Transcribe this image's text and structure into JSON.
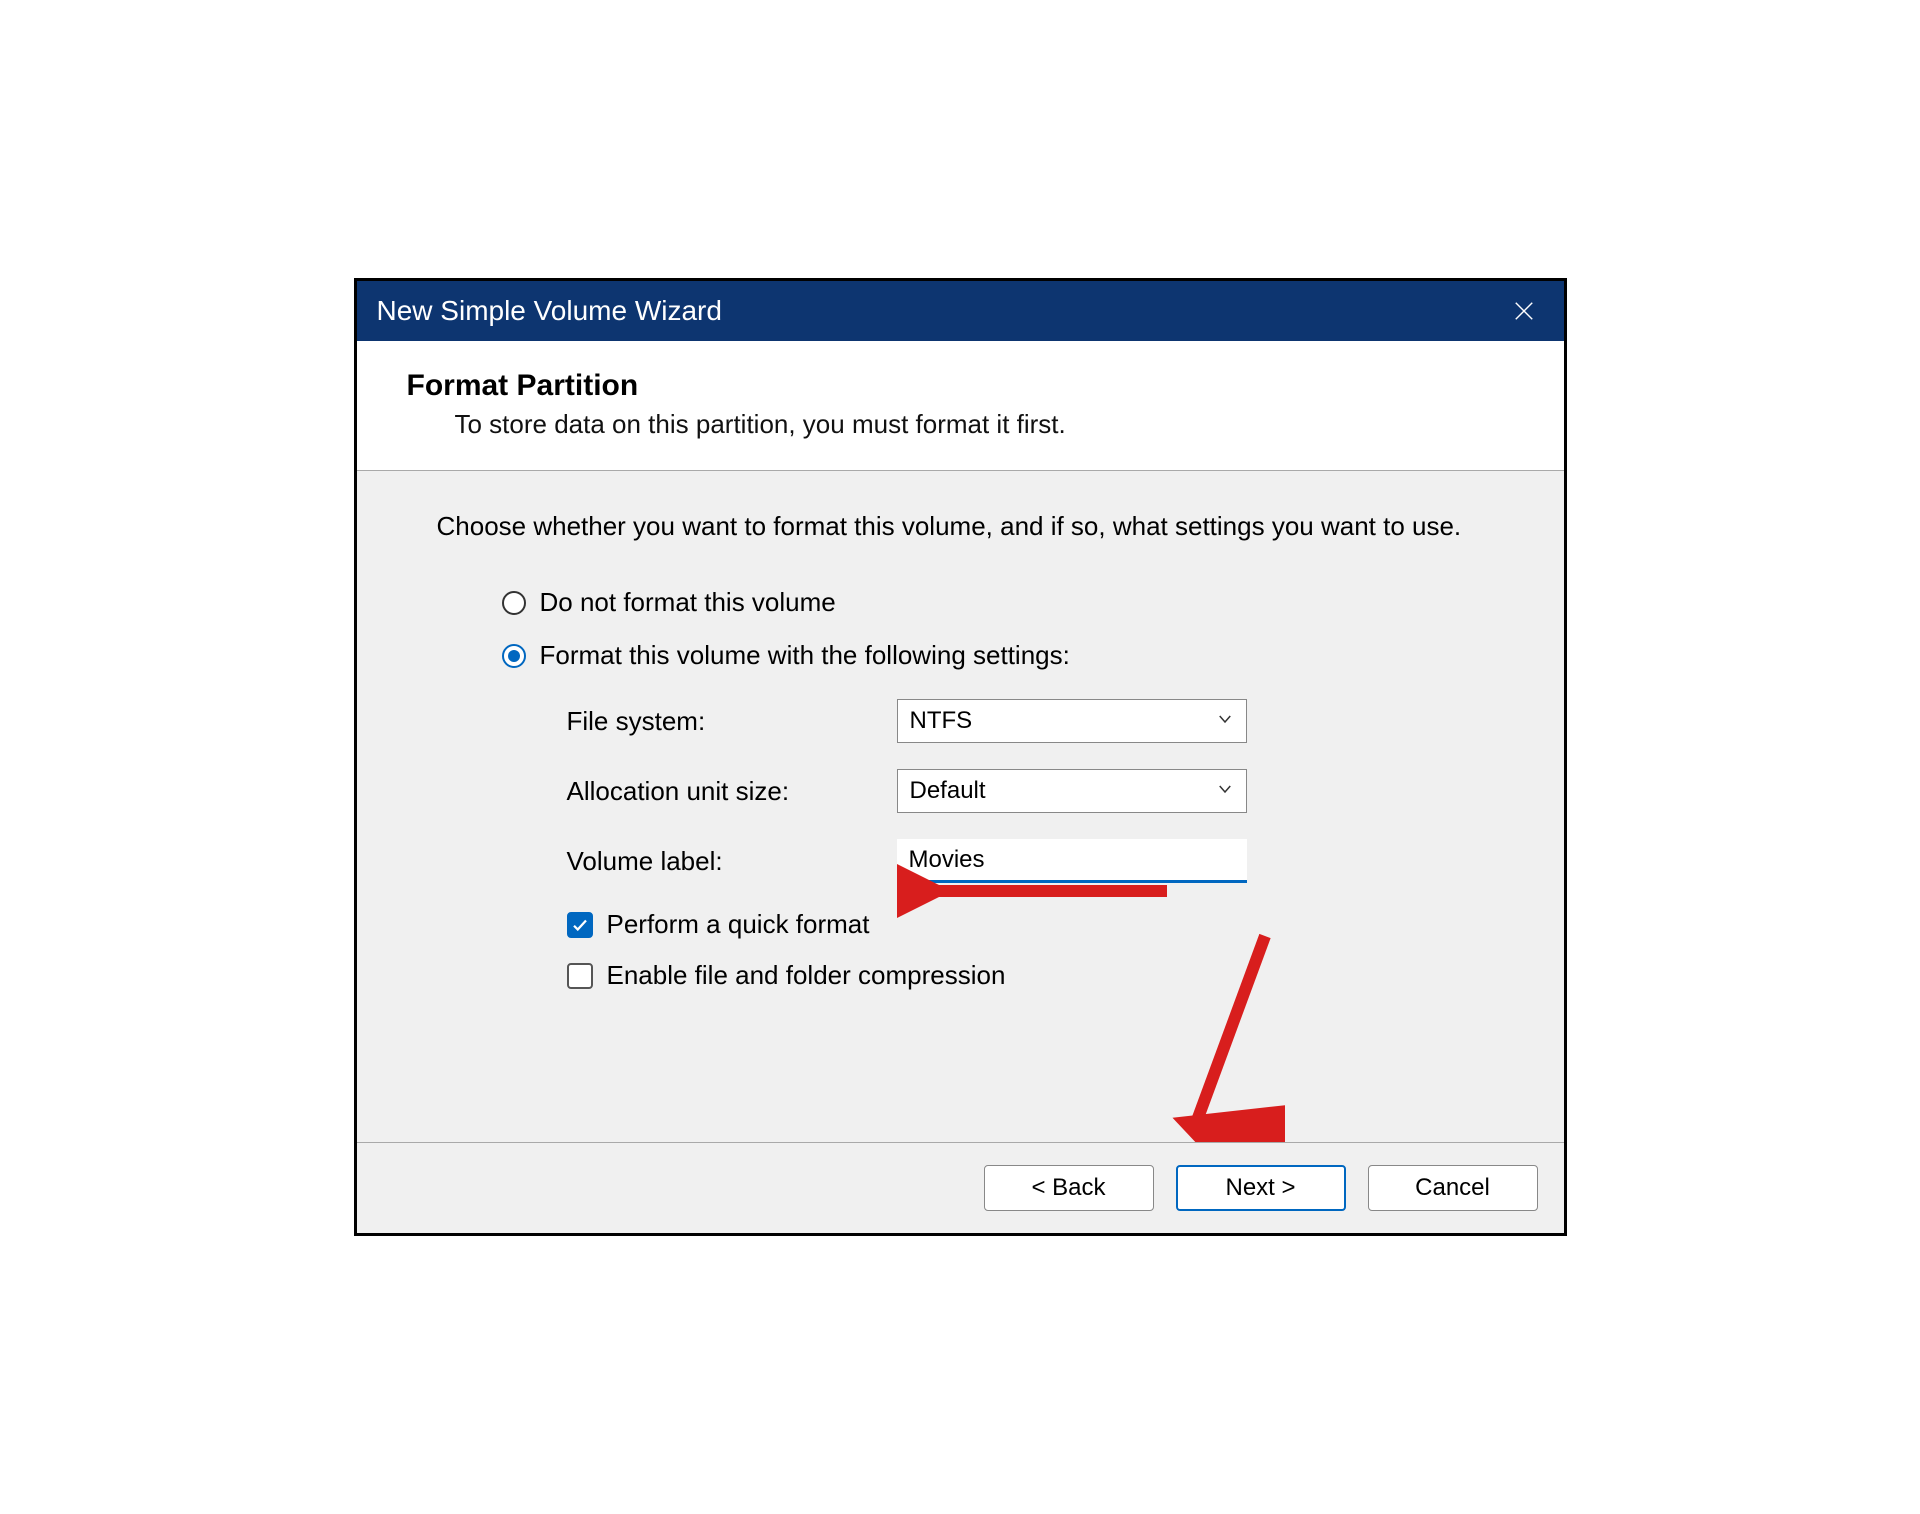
{
  "titlebar": {
    "title": "New Simple Volume Wizard"
  },
  "header": {
    "title": "Format Partition",
    "subtitle": "To store data on this partition, you must format it first."
  },
  "content": {
    "instruction": "Choose whether you want to format this volume, and if so, what settings you want to use.",
    "radios": {
      "no_format": "Do not format this volume",
      "format_with": "Format this volume with the following settings:"
    },
    "settings": {
      "file_system_label": "File system:",
      "file_system_value": "NTFS",
      "allocation_label": "Allocation unit size:",
      "allocation_value": "Default",
      "volume_label_label": "Volume label:",
      "volume_label_value": "Movies"
    },
    "checkboxes": {
      "quick_format": "Perform a quick format",
      "compression": "Enable file and folder compression"
    }
  },
  "buttons": {
    "back": "< Back",
    "next": "Next >",
    "cancel": "Cancel"
  },
  "colors": {
    "accent": "#0067c0",
    "titlebar": "#0d3570",
    "annotation": "#d81e1d"
  }
}
